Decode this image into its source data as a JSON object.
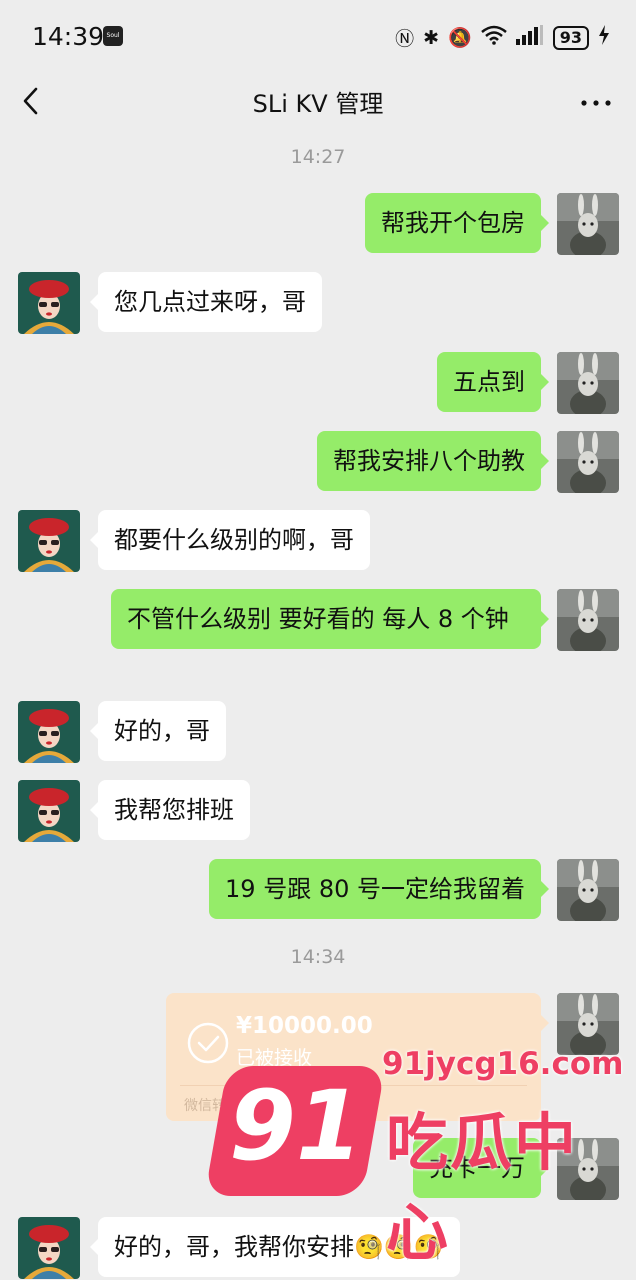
{
  "status_bar": {
    "time": "14:39",
    "app_badge": "Soul",
    "battery": "93",
    "icons": [
      "nfc-icon",
      "bluetooth-icon",
      "mute-icon",
      "wifi-icon",
      "signal-icon",
      "charging-icon"
    ]
  },
  "nav": {
    "title": "SLi KV 管理",
    "back_icon": "chevron-left-icon",
    "more_icon": "more-dots-icon"
  },
  "timestamps": [
    "14:27",
    "14:34"
  ],
  "messages": [
    {
      "side": "out",
      "text": "帮我开个包房"
    },
    {
      "side": "in",
      "text": "您几点过来呀，哥"
    },
    {
      "side": "out",
      "text": "五点到"
    },
    {
      "side": "out",
      "text": "帮我安排八个助教"
    },
    {
      "side": "in",
      "text": "都要什么级别的啊，哥"
    },
    {
      "side": "out",
      "text": "不管什么级别 要好看的 每人 8 个钟"
    },
    {
      "side": "in",
      "text": "好的，哥"
    },
    {
      "side": "in",
      "text": "我帮您排班"
    },
    {
      "side": "out",
      "text": "19 号跟 80 号一定给我留着"
    },
    {
      "side": "out",
      "text": "充卡一万"
    },
    {
      "side": "in",
      "text": "好的，哥，我帮你安排🧐🧐🧐"
    }
  ],
  "transfer": {
    "amount": "¥10000.00",
    "status": "已被接收",
    "footer": "微信转账"
  },
  "watermark": {
    "logo": "91",
    "url": "91jycg16.com",
    "name": "吃瓜中心"
  },
  "colors": {
    "background": "#ededed",
    "outgoing_bubble": "#95ec69",
    "incoming_bubble": "#ffffff",
    "transfer_card": "#fbe3c9",
    "watermark": "#ee3f63"
  }
}
